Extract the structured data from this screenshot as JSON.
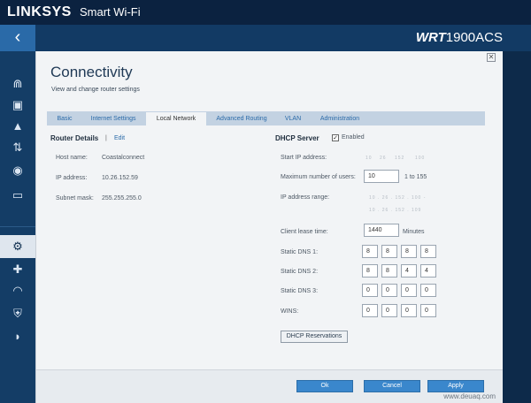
{
  "header": {
    "brand": "LINKSYS",
    "brand_sub": "Smart Wi-Fi",
    "model_prefix": "WRT",
    "model": "1900ACS",
    "back_icon": "chevron-left-icon"
  },
  "sidebar": {
    "items": [
      {
        "name": "network-map",
        "icon": "router-icon",
        "glyph": "⋒"
      },
      {
        "name": "guest-access",
        "icon": "briefcase-icon",
        "glyph": "▣"
      },
      {
        "name": "parental-controls",
        "icon": "warning-icon",
        "glyph": "▲"
      },
      {
        "name": "media-prioritization",
        "icon": "prioritize-icon",
        "glyph": "⇅"
      },
      {
        "name": "speed-test",
        "icon": "speedometer-icon",
        "glyph": "◉"
      },
      {
        "name": "external-storage",
        "icon": "storage-icon",
        "glyph": "▭"
      },
      {
        "name": "connectivity",
        "icon": "gears-icon",
        "glyph": "⚙",
        "active": true
      },
      {
        "name": "troubleshooting",
        "icon": "first-aid-icon",
        "glyph": "✚"
      },
      {
        "name": "wireless",
        "icon": "wifi-icon",
        "glyph": "◠"
      },
      {
        "name": "security",
        "icon": "shield-icon",
        "glyph": "⛨"
      },
      {
        "name": "openvpn",
        "icon": "vpn-icon",
        "glyph": "◗"
      }
    ]
  },
  "page": {
    "title": "Connectivity",
    "subtitle": "View and change router settings"
  },
  "tabs": [
    "Basic",
    "Internet Settings",
    "Local Network",
    "Advanced Routing",
    "VLAN",
    "Administration"
  ],
  "router": {
    "title": "Router Details",
    "separator": "|",
    "edit": "Edit",
    "rows": [
      {
        "label": "Host name:",
        "value": "Coastalconnect"
      },
      {
        "label": "IP address:",
        "value": "10.26.152.59"
      },
      {
        "label": "Subnet mask:",
        "value": "255.255.255.0"
      }
    ]
  },
  "dhcp": {
    "title": "DHCP Server",
    "enabled_label": "Enabled",
    "enabled": true,
    "start_ip_label": "Start IP address:",
    "start_ip_blurred": [
      "10",
      "26",
      "152",
      "100"
    ],
    "max_users_label": "Maximum number of users:",
    "max_users": "10",
    "max_users_range": "1 to 155",
    "ip_range_label": "IP address range:",
    "ip_range_blurred": [
      "10 . 26 . 152 . 100 -",
      "10 . 26 . 152 . 109"
    ],
    "lease_label": "Client lease time:",
    "lease": "1440",
    "lease_unit": "Minutes",
    "dns1_label": "Static DNS 1:",
    "dns1": [
      "8",
      "8",
      "8",
      "8"
    ],
    "dns2_label": "Static DNS 2:",
    "dns2": [
      "8",
      "8",
      "4",
      "4"
    ],
    "dns3_label": "Static DNS 3:",
    "dns3": [
      "0",
      "0",
      "0",
      "0"
    ],
    "wins_label": "WINS:",
    "wins": [
      "0",
      "0",
      "0",
      "0"
    ],
    "reservations_button": "DHCP Reservations"
  },
  "footer": {
    "ok": "Ok",
    "cancel": "Cancel",
    "apply": "Apply",
    "watermark": "www.deuaq.com"
  }
}
